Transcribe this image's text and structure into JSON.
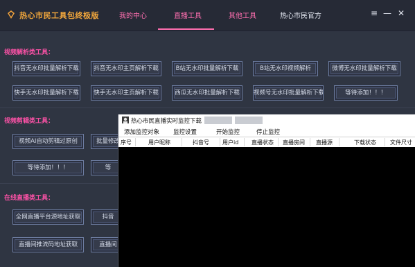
{
  "app": {
    "title": "热心市民工具包终极版",
    "tabs": [
      "我的中心",
      "直播工具",
      "其他工具",
      "热心市民官方"
    ],
    "active_tab": "直播工具",
    "accent_color": "#ff6fb0",
    "section_color": "#ff52a8"
  },
  "window_controls": {
    "menu_icon": "≡",
    "minimize_icon": "—",
    "close_icon": "✕"
  },
  "sections": {
    "video_parse": {
      "title": "视频解析类工具：",
      "buttons": [
        "抖音无水印批量解析下载",
        "抖音无水印主页解析下载",
        "B站无水印批量解析下载",
        "B站无水印视频解析",
        "微博无水印批量解析下载",
        "快手无水印批量解析下载",
        "快手无水印主页解析下载",
        "西瓜无水印批量解析下载",
        "视频号无水印批量解析下载",
        "等待添加！！！"
      ]
    },
    "video_edit": {
      "title": "视频剪辑类工具：",
      "buttons": [
        "视频AI自动剪辑过原创",
        "批量修改",
        "等待添加！！！",
        "等"
      ]
    },
    "live": {
      "title": "在线直播类工具：",
      "buttons": [
        "全网直播平台源地址获取",
        "抖音",
        "直播间推流码地址获取",
        "直播间"
      ]
    }
  },
  "overlay": {
    "title": "热心市民直播实时监控下载",
    "menu": [
      "添加监控对象",
      "监控设置",
      "开始监控",
      "停止监控"
    ],
    "columns": [
      "序号",
      "用户昵称",
      "抖音号",
      "用户id",
      "直播状态",
      "直播房间",
      "直播源",
      "下载状态",
      "文件尺寸"
    ]
  }
}
